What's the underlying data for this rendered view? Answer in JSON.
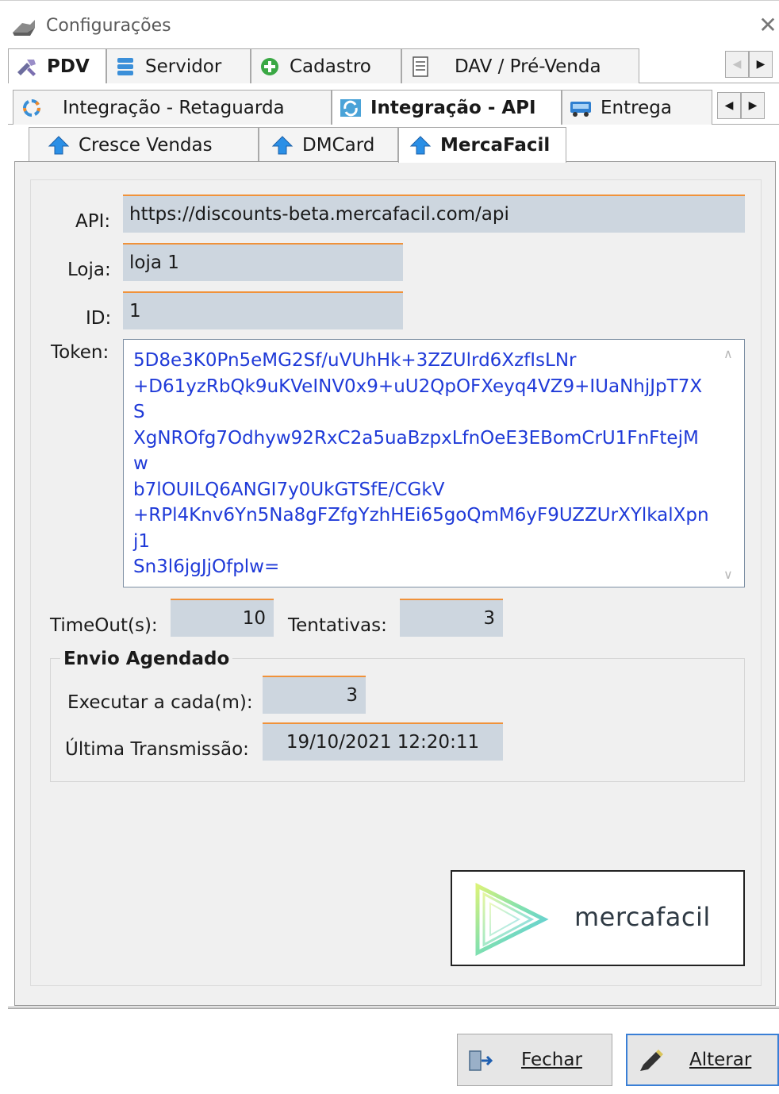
{
  "window": {
    "title": "Configurações",
    "close_symbol": "✕"
  },
  "tabs_row1": [
    {
      "label": "PDV",
      "icon": "tools-icon",
      "active": true
    },
    {
      "label": "Servidor",
      "icon": "database-icon"
    },
    {
      "label": "Cadastro",
      "icon": "add-circle-icon"
    },
    {
      "label": "DAV / Pré-Venda",
      "icon": "document-icon"
    }
  ],
  "tabs_row2": [
    {
      "label": "Integração - Retaguarda",
      "icon": "sync-icon"
    },
    {
      "label": "Integração - API",
      "icon": "sync-icon",
      "active": true
    },
    {
      "label": "Entrega",
      "icon": "truck-icon"
    }
  ],
  "tabs_row3": [
    {
      "label": "Cresce Vendas",
      "icon": "arrow-up-icon"
    },
    {
      "label": "DMCard",
      "icon": "arrow-up-icon"
    },
    {
      "label": "MercaFacil",
      "icon": "arrow-up-icon",
      "active": true
    }
  ],
  "scroll_buttons": {
    "left": "◀",
    "right": "▶"
  },
  "form": {
    "api_label": "API:",
    "api_value": "https://discounts-beta.mercafacil.com/api",
    "loja_label": "Loja:",
    "loja_value": "loja 1",
    "id_label": "ID:",
    "id_value": "1",
    "token_label": "Token:",
    "token_value": "5D8e3K0Pn5eMG2Sf/uVUhHk+3ZZUlrd6XzfIsLNr\n+D61yzRbQk9uKVeINV0x9+uU2QpOFXeyq4VZ9+IUaNhjJpT7XS\nXgNROfg7Odhyw92RxC2a5uaBzpxLfnOeE3EBomCrU1FnFtejMw\nb7lOUILQ6ANGI7y0UkGTSfE/CGkV\n+RPl4Knv6Yn5Na8gFZfgYzhHEi65goQmM6yF9UZZUrXYlkalXpnj1\nSn3l6jgJjOfplw=",
    "timeout_label": "TimeOut(s):",
    "timeout_value": "10",
    "tentativas_label": "Tentativas:",
    "tentativas_value": "3"
  },
  "envio_agendado": {
    "title": "Envio Agendado",
    "executar_label": "Executar a cada(m):",
    "executar_value": "3",
    "ultima_label": "Última Transmissão:",
    "ultima_value": "19/10/2021 12:20:11"
  },
  "logo": {
    "text": "mercafacil"
  },
  "buttons": {
    "fechar": "Fechar",
    "alterar": "Alterar"
  },
  "colors": {
    "field_bg": "#cdd6df",
    "field_accent": "#f0923a",
    "token_text": "#1f3ad8",
    "primary_border": "#3a7fd6"
  }
}
